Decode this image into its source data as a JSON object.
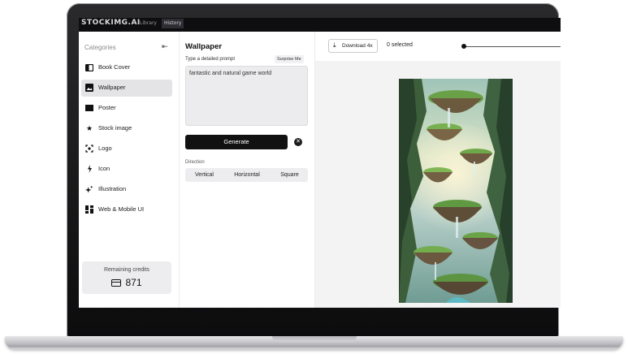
{
  "app": {
    "brand": "STOCKIMG.AI",
    "tabs": [
      {
        "label": "Library"
      },
      {
        "label": "History"
      }
    ]
  },
  "sidebar": {
    "title": "Categories",
    "items": [
      {
        "label": "Book Cover",
        "icon": "book-cover-icon"
      },
      {
        "label": "Wallpaper",
        "icon": "wallpaper-icon",
        "active": true
      },
      {
        "label": "Poster",
        "icon": "poster-icon"
      },
      {
        "label": "Stock image",
        "icon": "star-icon"
      },
      {
        "label": "Logo",
        "icon": "logo-icon"
      },
      {
        "label": "Icon",
        "icon": "bolt-icon"
      },
      {
        "label": "Illustration",
        "icon": "sparkle-icon"
      },
      {
        "label": "Web & Mobile UI",
        "icon": "grid-icon"
      }
    ],
    "credits": {
      "label": "Remaining credits",
      "value": "871"
    }
  },
  "panel": {
    "title": "Wallpaper",
    "prompt_label": "Type a detailed prompt",
    "surprise_label": "Surprise Me",
    "prompt_value": "fantastic and natural game world",
    "generate_label": "Generate",
    "direction_label": "Direction",
    "directions": [
      "Vertical",
      "Horizontal",
      "Square"
    ]
  },
  "output": {
    "download_label": "Download 4x",
    "selected_text": "0 selected",
    "zoom_level": 0.02
  },
  "colors": {
    "accent": "#111111",
    "active_item_bg": "#e4e4e6",
    "panel_bg": "#f3f3f4"
  }
}
